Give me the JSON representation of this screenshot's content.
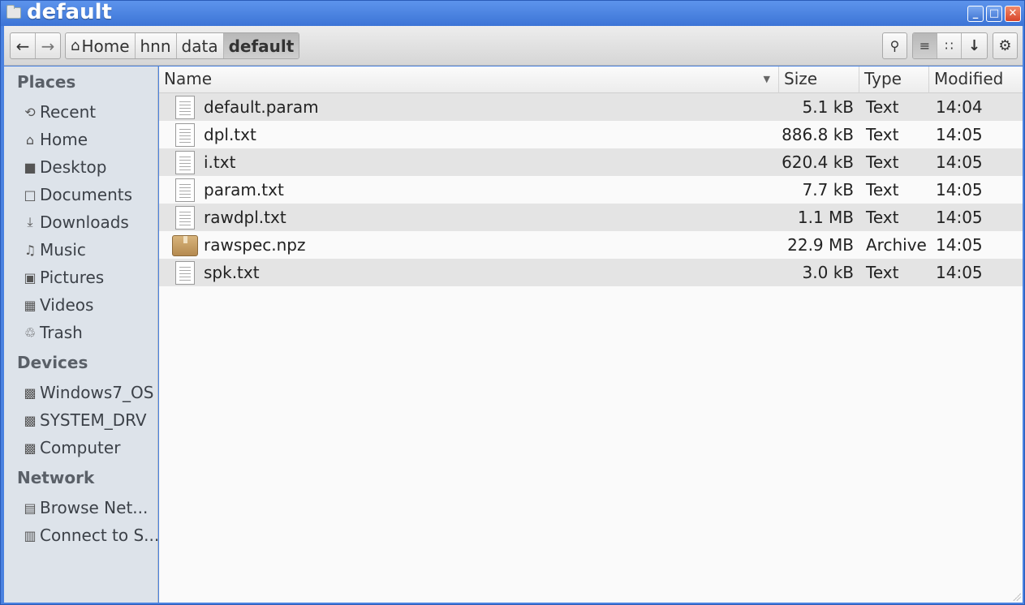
{
  "window": {
    "title": "default"
  },
  "toolbar": {
    "back_icon": "←",
    "forward_icon": "→",
    "breadcrumbs": [
      {
        "label": "Home",
        "icon": "⌂"
      },
      {
        "label": "hnn"
      },
      {
        "label": "data"
      },
      {
        "label": "default"
      }
    ],
    "search_icon": "⚲",
    "list_icon": "≡",
    "grid_icon": "∷",
    "down_icon": "↓",
    "gear_icon": "⚙"
  },
  "sidebar": {
    "places_title": "Places",
    "places": [
      {
        "label": "Recent",
        "icon": "⟲"
      },
      {
        "label": "Home",
        "icon": "⌂"
      },
      {
        "label": "Desktop",
        "icon": "■"
      },
      {
        "label": "Documents",
        "icon": "□"
      },
      {
        "label": "Downloads",
        "icon": "⤓"
      },
      {
        "label": "Music",
        "icon": "♫"
      },
      {
        "label": "Pictures",
        "icon": "▣"
      },
      {
        "label": "Videos",
        "icon": "▦"
      },
      {
        "label": "Trash",
        "icon": "♲"
      }
    ],
    "devices_title": "Devices",
    "devices": [
      {
        "label": "Windows7_OS",
        "icon": "▩"
      },
      {
        "label": "SYSTEM_DRV",
        "icon": "▩"
      },
      {
        "label": "Computer",
        "icon": "▩"
      }
    ],
    "network_title": "Network",
    "network": [
      {
        "label": "Browse Net...",
        "icon": "▤"
      },
      {
        "label": "Connect to S...",
        "icon": "▥"
      }
    ]
  },
  "columns": {
    "name": "Name",
    "size": "Size",
    "type": "Type",
    "modified": "Modified"
  },
  "files": [
    {
      "name": "default.param",
      "size": "5.1 kB",
      "type": "Text",
      "modified": "14:04",
      "kind": "text"
    },
    {
      "name": "dpl.txt",
      "size": "886.8 kB",
      "type": "Text",
      "modified": "14:05",
      "kind": "text"
    },
    {
      "name": "i.txt",
      "size": "620.4 kB",
      "type": "Text",
      "modified": "14:05",
      "kind": "text"
    },
    {
      "name": "param.txt",
      "size": "7.7 kB",
      "type": "Text",
      "modified": "14:05",
      "kind": "text"
    },
    {
      "name": "rawdpl.txt",
      "size": "1.1 MB",
      "type": "Text",
      "modified": "14:05",
      "kind": "text"
    },
    {
      "name": "rawspec.npz",
      "size": "22.9 MB",
      "type": "Archive",
      "modified": "14:05",
      "kind": "archive"
    },
    {
      "name": "spk.txt",
      "size": "3.0 kB",
      "type": "Text",
      "modified": "14:05",
      "kind": "text"
    }
  ]
}
